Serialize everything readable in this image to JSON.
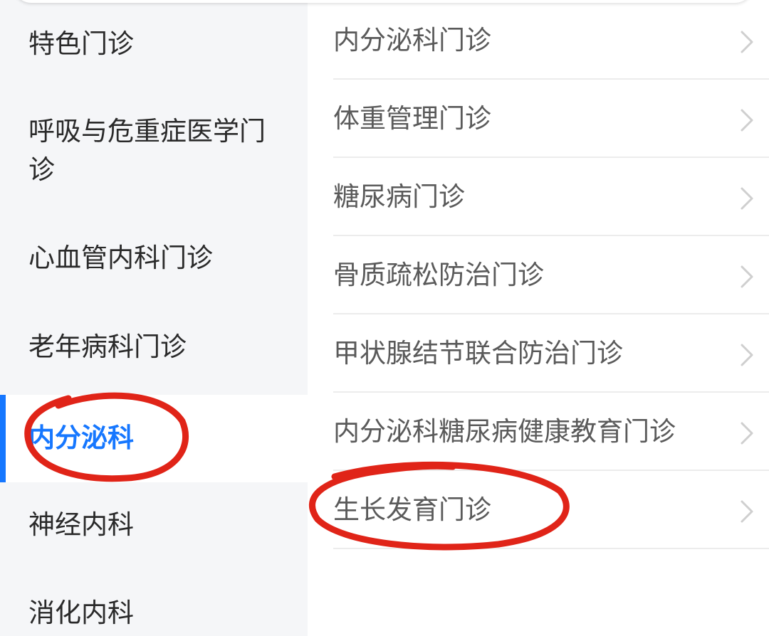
{
  "sidebar": {
    "items": [
      {
        "label": "特色门诊"
      },
      {
        "label": "呼吸与危重症医学门诊"
      },
      {
        "label": "心血管内科门诊"
      },
      {
        "label": "老年病科门诊"
      },
      {
        "label": "内分泌科",
        "active": true
      },
      {
        "label": "神经内科"
      },
      {
        "label": "消化内科"
      }
    ]
  },
  "clinics": {
    "items": [
      {
        "label": "内分泌科门诊"
      },
      {
        "label": "体重管理门诊"
      },
      {
        "label": "糖尿病门诊"
      },
      {
        "label": "骨质疏松防治门诊"
      },
      {
        "label": "甲状腺结节联合防治门诊"
      },
      {
        "label": "内分泌科糖尿病健康教育门诊"
      },
      {
        "label": "生长发育门诊"
      }
    ]
  },
  "icons": {
    "row_arrow": "chevron-right-icon"
  },
  "colors": {
    "accent": "#1677ff",
    "annotation": "#e02418",
    "sidebar_bg": "#f5f6f8"
  }
}
